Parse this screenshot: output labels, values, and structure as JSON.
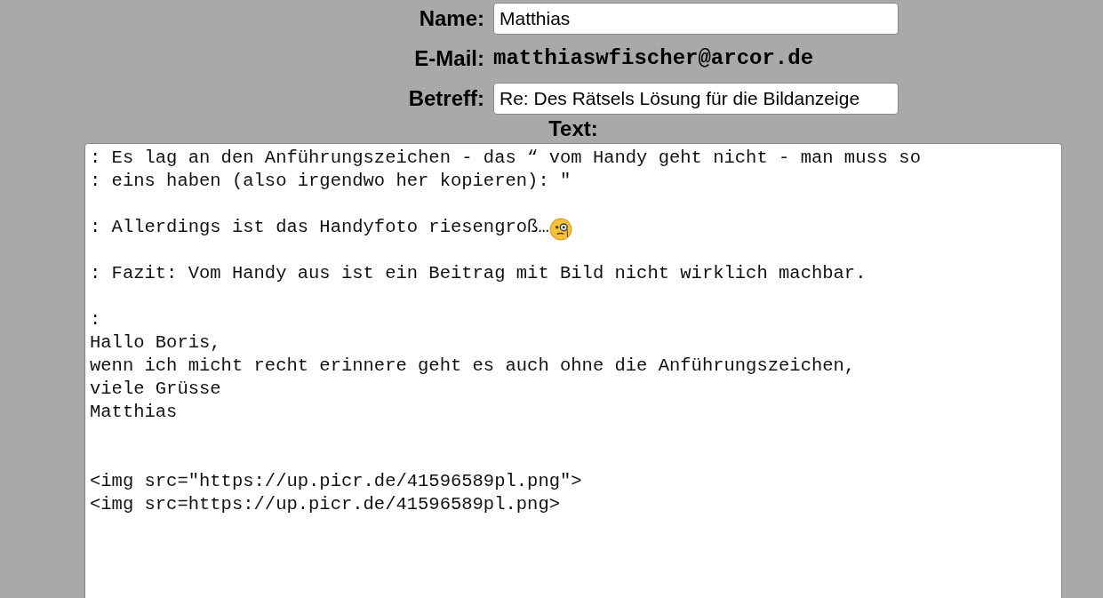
{
  "fields": [
    {
      "kind": "input",
      "label": "Name:",
      "value": "Matthias"
    },
    {
      "kind": "static",
      "label": "E-Mail:",
      "value": "matthiaswfischer@arcor.de"
    },
    {
      "kind": "input",
      "label": "Betreff:",
      "value": "Re: Des Rätsels Lösung für die Bildanzeige"
    }
  ],
  "message": {
    "label": "Text:",
    "lines": [
      {
        "kind": "text",
        "text": ": Es lag an den Anführungszeichen - das “ vom Handy geht nicht - man muss so"
      },
      {
        "kind": "text",
        "text": ": eins haben (also irgendwo her kopieren): \""
      },
      {
        "kind": "blank"
      },
      {
        "kind": "emoji",
        "text": ": Allerdings ist das Handyfoto riesengroß…"
      },
      {
        "kind": "blank"
      },
      {
        "kind": "text",
        "text": ": Fazit: Vom Handy aus ist ein Beitrag mit Bild nicht wirklich machbar."
      },
      {
        "kind": "blank"
      },
      {
        "kind": "text",
        "text": ":"
      },
      {
        "kind": "text",
        "text": "Hallo Boris,"
      },
      {
        "kind": "text",
        "text": "wenn ich micht recht erinnere geht es auch ohne die Anführungszeichen,"
      },
      {
        "kind": "text",
        "text": "viele Grüsse"
      },
      {
        "kind": "text",
        "text": "Matthias"
      },
      {
        "kind": "blank"
      },
      {
        "kind": "blank"
      },
      {
        "kind": "text",
        "text": "<img src=\"https://up.picr.de/41596589pl.png\">"
      },
      {
        "kind": "text",
        "text": "<img src=https://up.picr.de/41596589pl.png>"
      }
    ]
  }
}
